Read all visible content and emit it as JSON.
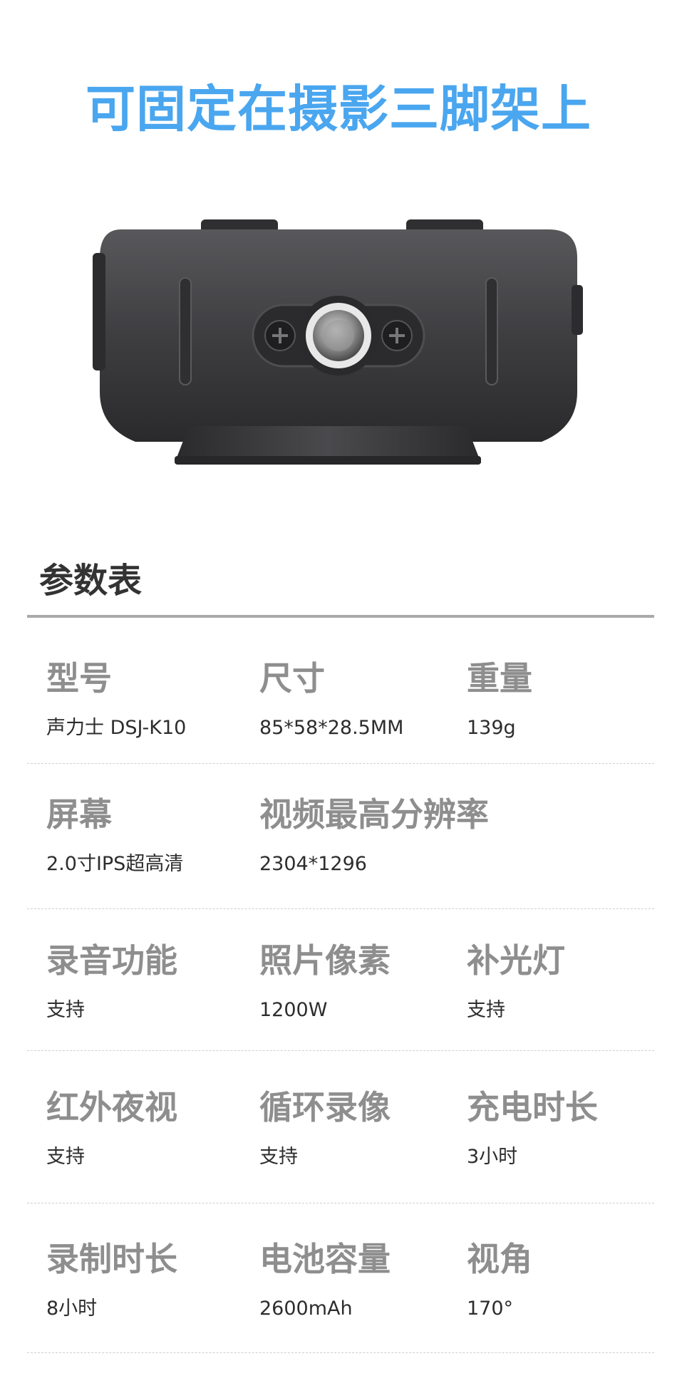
{
  "headline": "可固定在摄影三脚架上",
  "section_title": "参数表",
  "specs": [
    [
      {
        "label": "型号",
        "value": "声力士 DSJ-K10"
      },
      {
        "label": "尺寸",
        "value": "85*58*28.5MM"
      },
      {
        "label": "重量",
        "value": "139g"
      }
    ],
    [
      {
        "label": "屏幕",
        "value": "2.0寸IPS超高清"
      },
      {
        "label": "视频最高分辨率",
        "value": "2304*1296"
      },
      {
        "label": "",
        "value": ""
      }
    ],
    [
      {
        "label": "录音功能",
        "value": "支持"
      },
      {
        "label": "照片像素",
        "value": "1200W"
      },
      {
        "label": "补光灯",
        "value": "支持"
      }
    ],
    [
      {
        "label": "红外夜视",
        "value": "支持"
      },
      {
        "label": "循环录像",
        "value": "支持"
      },
      {
        "label": "充电时长",
        "value": "3小时"
      }
    ],
    [
      {
        "label": "录制时长",
        "value": "8小时"
      },
      {
        "label": "电池容量",
        "value": "2600mAh"
      },
      {
        "label": "视角",
        "value": "170°"
      }
    ]
  ],
  "colors": {
    "headline": "#4aa6ef",
    "label": "#8e8e8e",
    "value": "#2d2d2d",
    "device_body": "#3b3b3d"
  },
  "image": {
    "subject": "device-bottom-tripod-mount"
  }
}
